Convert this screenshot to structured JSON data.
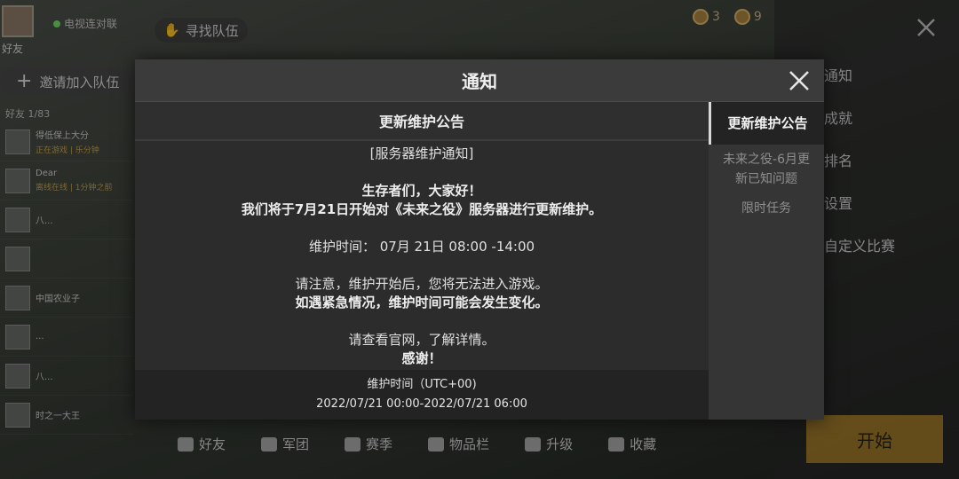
{
  "lobby": {
    "connection_text": "电视连对联",
    "player_label": "好友",
    "find_team": "寻找队伍",
    "invite_label": "邀请加入队伍",
    "friends_title": "好友 1/83",
    "friends": [
      {
        "name": "得低保上大分",
        "status": "正在游戏 | 乐分钟"
      },
      {
        "name": "Dear",
        "status": "离线在线 | 1分钟之前"
      },
      {
        "name": "八...",
        "status": ""
      },
      {
        "name": "",
        "status": ""
      },
      {
        "name": "中国农业子",
        "status": ""
      },
      {
        "name": "...",
        "status": ""
      },
      {
        "name": "八...",
        "status": ""
      },
      {
        "name": "时之一大王",
        "status": ""
      }
    ],
    "coin_a": "3",
    "coin_b": "9",
    "right_menu": [
      "通知",
      "成就",
      "排名",
      "设置",
      "自定义比赛"
    ],
    "start_label": "开始",
    "bottom_nav": [
      "好友",
      "军团",
      "赛季",
      "物品栏",
      "升级",
      "收藏"
    ]
  },
  "modal": {
    "title": "通知",
    "content_header": "更新维护公告",
    "body": {
      "line1": "[服务器维护通知]",
      "line2": "生存者们，大家好！",
      "line3": "我们将于7月21日开始对《未来之役》服务器进行更新维护。",
      "line4": "维护时间： 07月 21日 08:00 -14:00",
      "line5": "请注意，维护开始后，您将无法进入游戏。",
      "line6": "如遇紧急情况，维护时间可能会发生变化。",
      "line7": "请查看官网，了解详情。",
      "line8": "感谢！"
    },
    "footer_title": "维护时间（UTC+00)",
    "footer_time": "2022/07/21 00:00-2022/07/21 06:00",
    "tabs": [
      {
        "label": "更新维护公告",
        "active": true
      },
      {
        "label": "未来之役-6月更新已知问题",
        "active": false
      },
      {
        "label": "限时任务",
        "active": false
      }
    ]
  }
}
